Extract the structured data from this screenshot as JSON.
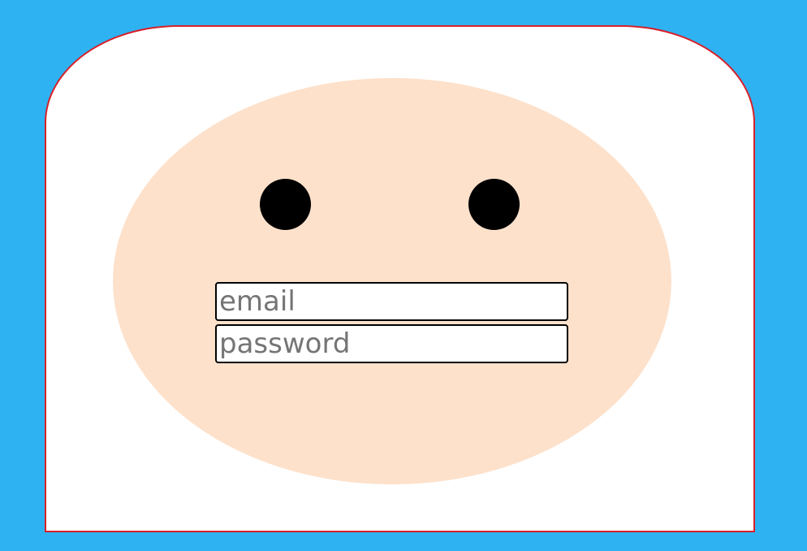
{
  "colors": {
    "background": "#2fb2f1",
    "hood": "#ffffff",
    "hood_border": "#d7202a",
    "face": "#fde1cb",
    "eyes": "#000000"
  },
  "login_form": {
    "email": {
      "value": "",
      "placeholder": "email"
    },
    "password": {
      "value": "",
      "placeholder": "password"
    }
  }
}
